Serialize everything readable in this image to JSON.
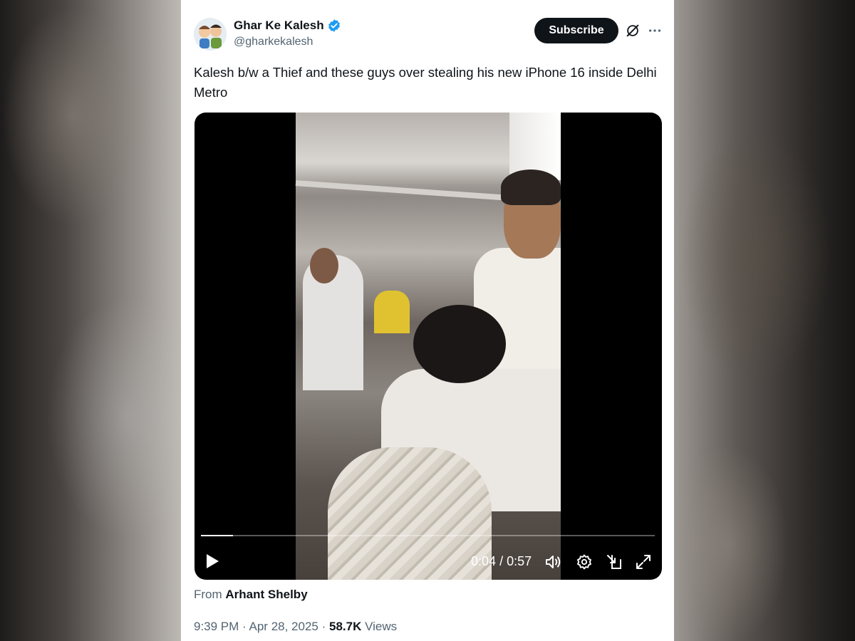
{
  "author": {
    "display_name": "Ghar Ke Kalesh",
    "handle": "@gharkekalesh",
    "verified": true,
    "verified_color": "#1d9bf0"
  },
  "header": {
    "subscribe_label": "Subscribe",
    "icons": [
      "grok-icon",
      "more-icon"
    ]
  },
  "tweet": {
    "text": "Kalesh b/w a Thief and these guys over stealing his new iPhone 16 inside Delhi Metro"
  },
  "video": {
    "current_time": "0:04",
    "duration": "0:57",
    "time_display": "0:04 / 0:57",
    "progress": 0.07,
    "controls": [
      "play-icon",
      "volume-icon",
      "settings-icon",
      "pip-icon",
      "fullscreen-icon"
    ]
  },
  "source": {
    "prefix": "From",
    "name": "Arhant Shelby"
  },
  "meta": {
    "time": "9:39 PM",
    "date": "Apr 28, 2025",
    "separator": "·",
    "views_count": "58.7K",
    "views_label": "Views"
  },
  "colors": {
    "text_primary": "#0f1419",
    "text_secondary": "#536471",
    "button_dark": "#0f1419"
  }
}
